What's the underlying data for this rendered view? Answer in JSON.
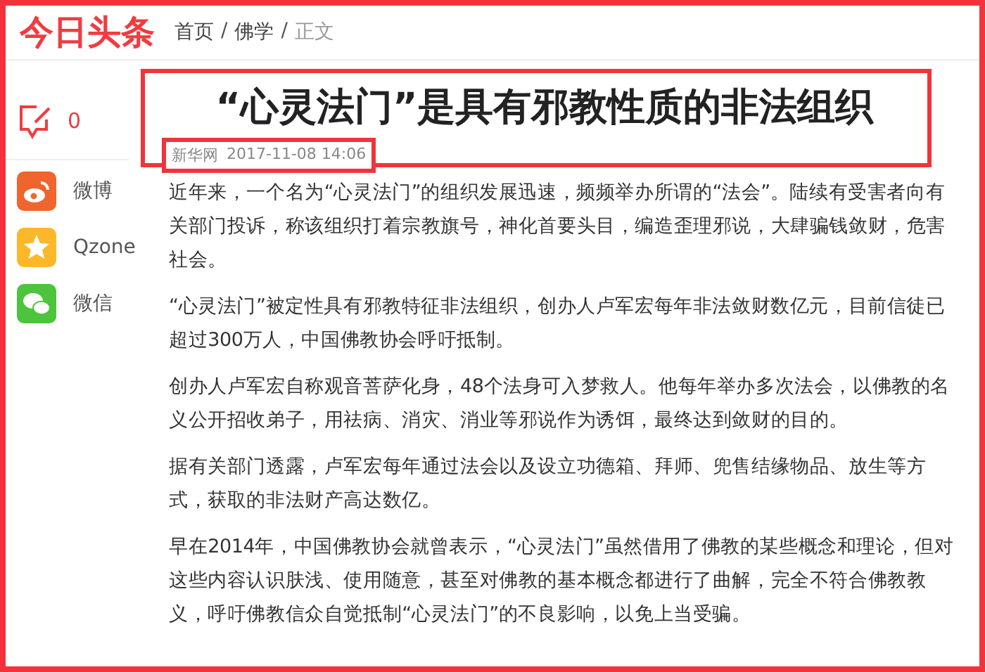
{
  "header": {
    "logo": "今日头条",
    "breadcrumb": [
      {
        "label": "首页",
        "current": false
      },
      {
        "label": "/",
        "kind": "separator"
      },
      {
        "label": "佛学",
        "current": false
      },
      {
        "label": "/",
        "kind": "separator"
      },
      {
        "label": "正文",
        "current": true
      }
    ]
  },
  "sidebar": {
    "comment_count": "0",
    "share": [
      {
        "kind": "weibo",
        "label": "微博"
      },
      {
        "kind": "qzone",
        "label": "Qzone"
      },
      {
        "kind": "wechat",
        "label": "微信"
      }
    ]
  },
  "article": {
    "title": "“心灵法门”是具有邪教性质的非法组织",
    "source": "新华网",
    "date": "2017-11-08 14:06",
    "paragraphs": [
      "近年来，一个名为“心灵法门”的组织发展迅速，频频举办所谓的“法会”。陆续有受害者向有关部门投诉，称该组织打着宗教旗号，神化首要头目，编造歪理邪说，大肆骗钱敛财，危害社会。",
      "“心灵法门”被定性具有邪教特征非法组织，创办人卢军宏每年非法敛财数亿元，目前信徒已超过300万人，中国佛教协会呼吁抵制。",
      "创办人卢军宏自称观音菩萨化身，48个法身可入梦救人。他每年举办多次法会，以佛教的名义公开招收弟子，用祛病、消灾、消业等邪说作为诱饵，最终达到敛财的目的。",
      "据有关部门透露，卢军宏每年通过法会以及设立功德箱、拜师、兜售结缘物品、放生等方式，获取的非法财产高达数亿。",
      "早在2014年，中国佛教协会就曾表示，“心灵法门”虽然借用了佛教的某些概念和理论，但对这些内容认识肤浅、使用随意，甚至对佛教的基本概念都进行了曲解，完全不符合佛教教义，呼吁佛教信众自觉抵制“心灵法门”的不良影响，以免上当受骗。"
    ]
  }
}
